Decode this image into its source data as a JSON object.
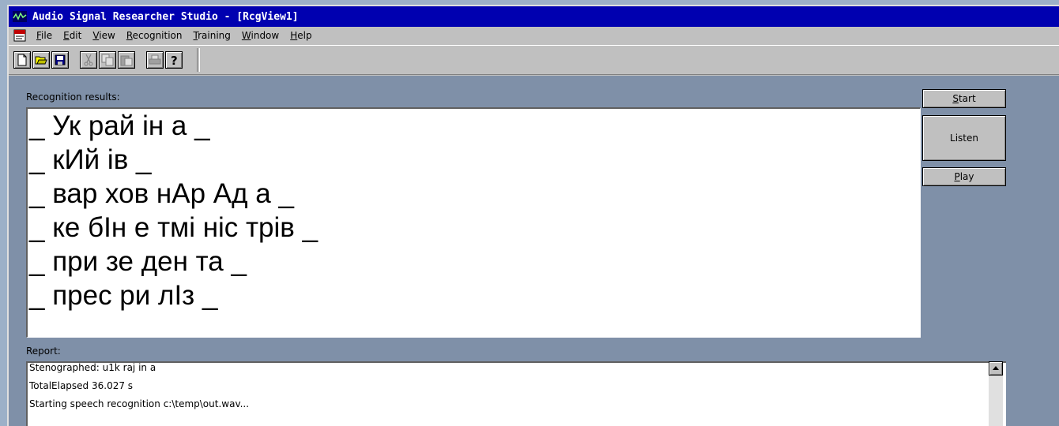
{
  "window": {
    "title": "Audio Signal Researcher Studio - [RcgView1]"
  },
  "menubar": {
    "items": [
      {
        "underline": "F",
        "rest": "ile"
      },
      {
        "underline": "E",
        "rest": "dit"
      },
      {
        "underline": "V",
        "rest": "iew"
      },
      {
        "underline": "R",
        "rest": "ecognition"
      },
      {
        "underline": "T",
        "rest": "raining"
      },
      {
        "underline": "W",
        "rest": "indow"
      },
      {
        "underline": "H",
        "rest": "elp"
      }
    ]
  },
  "toolbar": {
    "buttons": [
      "new-document-icon",
      "open-folder-icon",
      "save-disk-icon",
      "cut-scissors-icon",
      "copy-icon",
      "paste-icon",
      "print-icon",
      "help-question-icon"
    ]
  },
  "results": {
    "label": "Recognition results:",
    "lines": [
      "_ Ук рай ін а _",
      "_ кИй ів _",
      "_ вар хов нАр Ад а _",
      "_ ке бІн е тмі ніс трів _",
      "_ при зе ден та _",
      "_ прес ри лІз _"
    ]
  },
  "buttons": {
    "start": {
      "underline": "S",
      "rest": "tart"
    },
    "listen": "Listen",
    "play": {
      "underline": "P",
      "rest": "lay"
    }
  },
  "report": {
    "label": "Report:",
    "lines": [
      "Stenographed: u1k raj in a",
      "TotalElapsed 36.027 s",
      "Starting speech recognition c:\\temp\\out.wav..."
    ]
  },
  "colors": {
    "titlebar": "#0000b0",
    "background": "#9cb0c8",
    "panel": "#7f90a8"
  }
}
